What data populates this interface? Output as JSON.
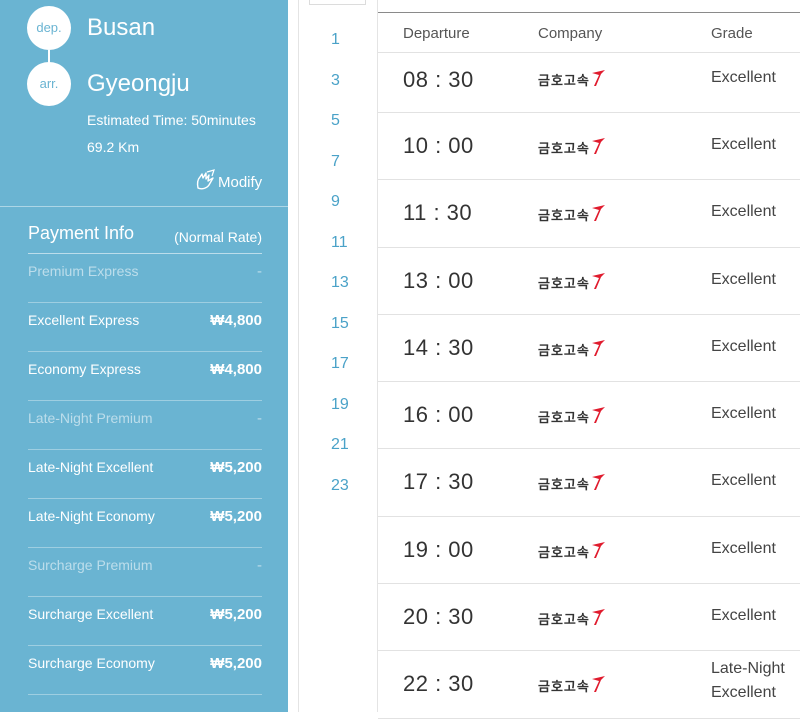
{
  "route": {
    "dep_label": "dep.",
    "dep_city": "Busan",
    "arr_label": "arr.",
    "arr_city": "Gyeongju",
    "estimated_time": "Estimated Time: 50minutes",
    "distance": "69.2 Km",
    "modify_label": "Modify"
  },
  "payment": {
    "title": "Payment Info",
    "note": "(Normal Rate)",
    "fares": [
      {
        "name": "Premium Express",
        "price": "-",
        "enabled": false
      },
      {
        "name": "Excellent Express",
        "price": "₩4,800",
        "enabled": true
      },
      {
        "name": "Economy Express",
        "price": "₩4,800",
        "enabled": true
      },
      {
        "name": "Late-Night Premium",
        "price": "-",
        "enabled": false
      },
      {
        "name": "Late-Night Excellent",
        "price": "₩5,200",
        "enabled": true
      },
      {
        "name": "Late-Night Economy",
        "price": "₩5,200",
        "enabled": true
      },
      {
        "name": "Surcharge Premium",
        "price": "-",
        "enabled": false
      },
      {
        "name": "Surcharge Excellent",
        "price": "₩5,200",
        "enabled": true
      },
      {
        "name": "Surcharge Economy",
        "price": "₩5,200",
        "enabled": true
      }
    ]
  },
  "hours": [
    "1",
    "3",
    "5",
    "7",
    "9",
    "11",
    "13",
    "15",
    "17",
    "19",
    "21",
    "23"
  ],
  "schedule": {
    "headers": {
      "departure": "Departure",
      "company": "Company",
      "grade": "Grade"
    },
    "company_name": "금호고속",
    "rows": [
      {
        "time": "08 : 30",
        "grade": "Excellent"
      },
      {
        "time": "10 : 00",
        "grade": "Excellent"
      },
      {
        "time": "11 : 30",
        "grade": "Excellent"
      },
      {
        "time": "13 : 00",
        "grade": "Excellent"
      },
      {
        "time": "14 : 30",
        "grade": "Excellent"
      },
      {
        "time": "16 : 00",
        "grade": "Excellent"
      },
      {
        "time": "17 : 30",
        "grade": "Excellent"
      },
      {
        "time": "19 : 00",
        "grade": "Excellent"
      },
      {
        "time": "20 : 30",
        "grade": "Excellent"
      },
      {
        "time": "22 : 30",
        "grade": "Late-Night Excellent"
      }
    ]
  },
  "colors": {
    "panel": "#6ab4d2",
    "accent_link": "#4aa2c8",
    "logo_red": "#e01b2d"
  },
  "icons": {
    "modify": "hand-pencil-icon",
    "company_logo": "kumho-logo-icon"
  }
}
